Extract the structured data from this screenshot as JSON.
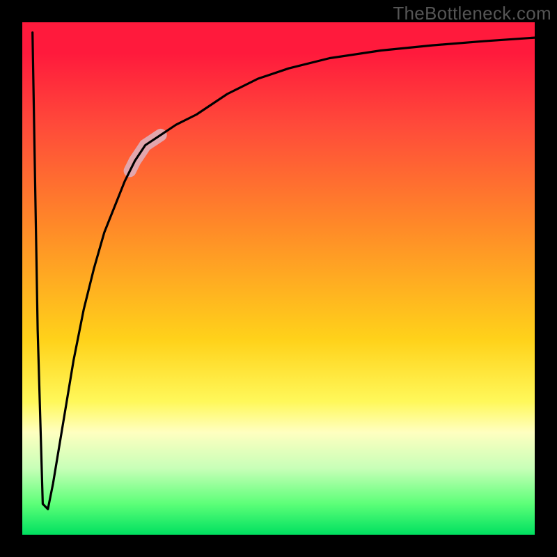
{
  "watermark": "TheBottleneck.com",
  "chart_data": {
    "type": "line",
    "title": "",
    "xlabel": "",
    "ylabel": "",
    "xlim": [
      0,
      100
    ],
    "ylim": [
      0,
      100
    ],
    "grid": false,
    "legend": false,
    "series": [
      {
        "name": "curve",
        "x": [
          2,
          3,
          4,
          5,
          6,
          8,
          10,
          12,
          14,
          16,
          18,
          20,
          22,
          24,
          27,
          30,
          34,
          40,
          46,
          52,
          60,
          70,
          80,
          90,
          100
        ],
        "y": [
          98,
          40,
          6,
          5,
          10,
          22,
          34,
          44,
          52,
          59,
          64,
          69,
          73,
          76,
          78,
          80,
          82,
          86,
          89,
          91,
          93,
          94.5,
          95.5,
          96.3,
          97
        ]
      }
    ],
    "highlight": {
      "x_range": [
        21,
        27
      ],
      "color": "#e2a6ad"
    }
  }
}
